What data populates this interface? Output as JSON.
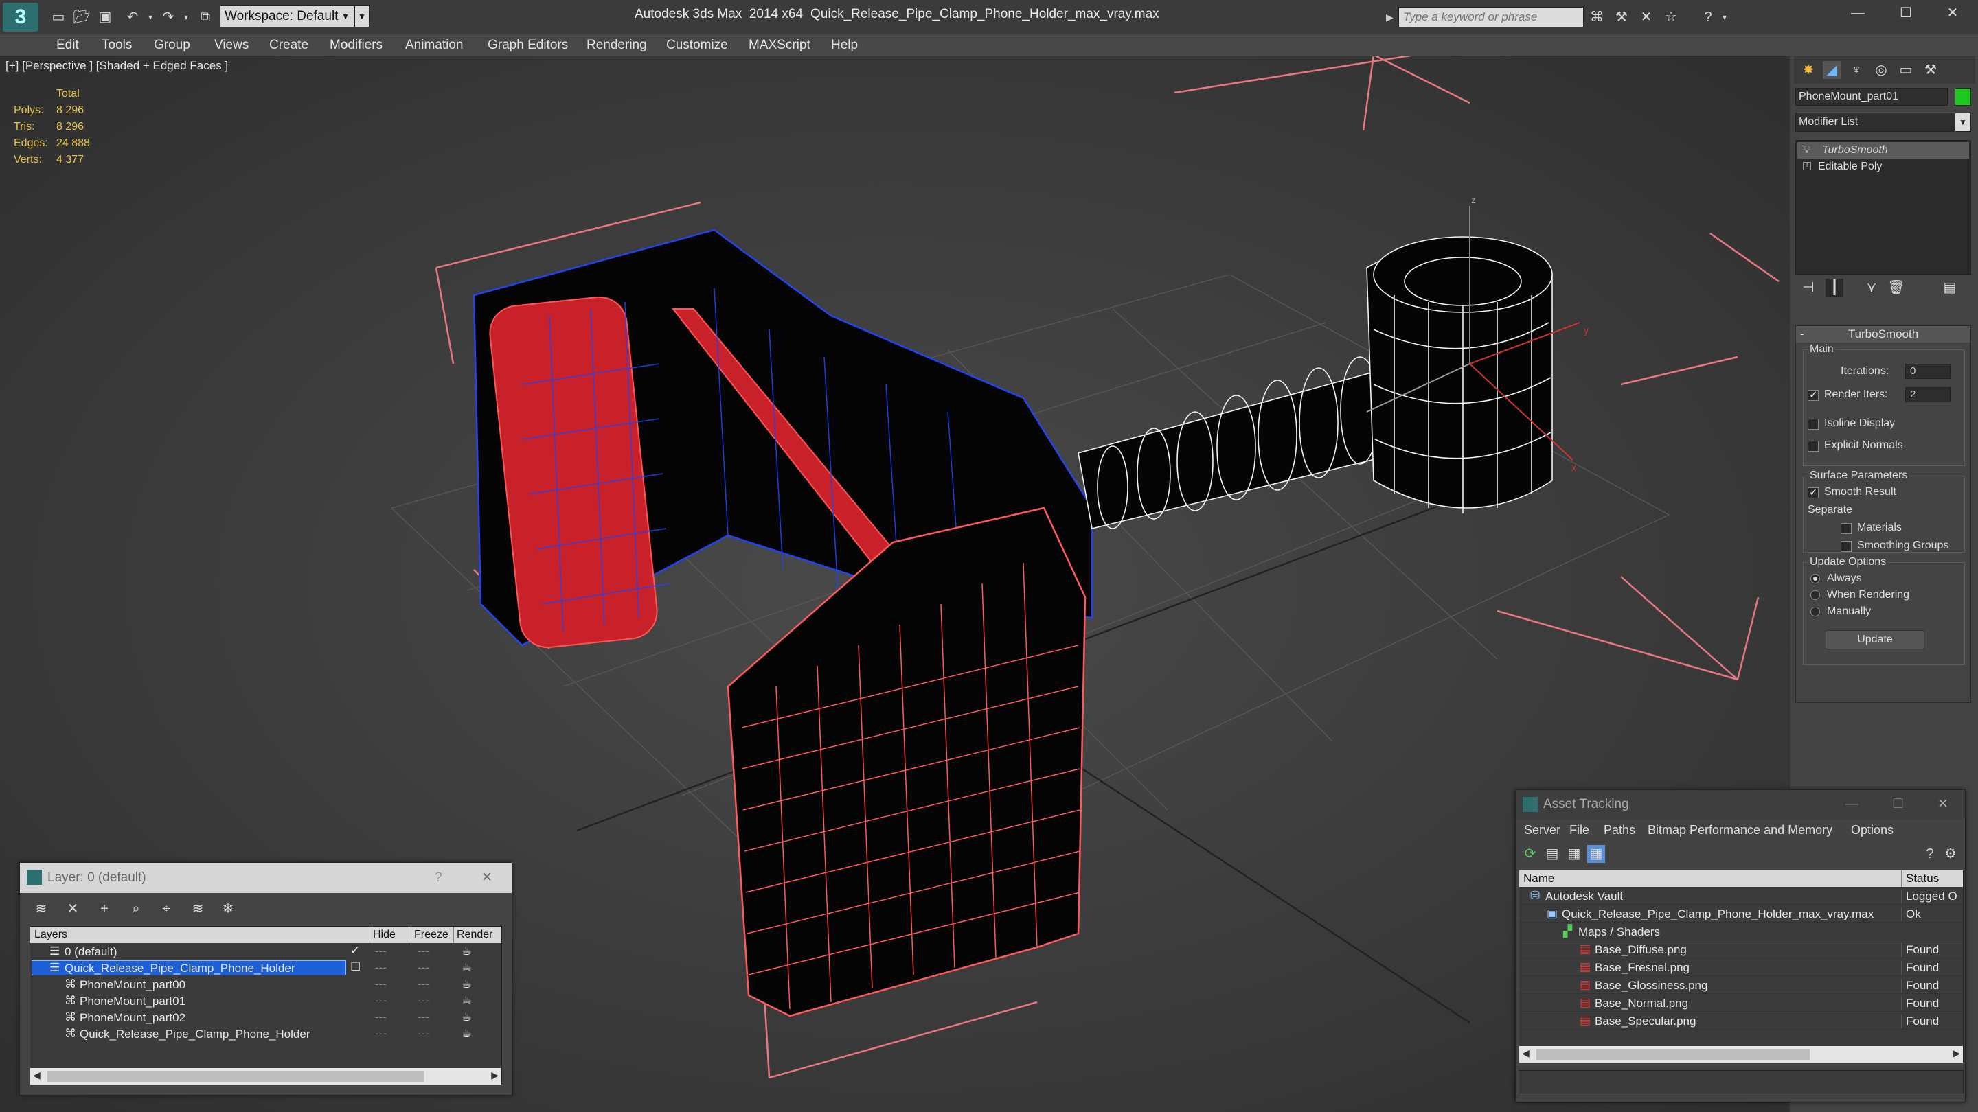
{
  "app": {
    "title": "Autodesk 3ds Max  2014 x64",
    "filename": "Quick_Release_Pipe_Clamp_Phone_Holder_max_vray.max",
    "workspace": "Workspace: Default",
    "search_placeholder": "Type a keyword or phrase"
  },
  "menu": [
    "Edit",
    "Tools",
    "Group",
    "Views",
    "Create",
    "Modifiers",
    "Animation",
    "Graph Editors",
    "Rendering",
    "Customize",
    "MAXScript",
    "Help"
  ],
  "viewport": {
    "label": "[+] [Perspective ] [Shaded + Edged Faces ]",
    "stats": {
      "header": "Total",
      "rows": [
        {
          "label": "Polys:",
          "value": "8 296"
        },
        {
          "label": "Tris:",
          "value": "8 296"
        },
        {
          "label": "Edges:",
          "value": "24 888"
        },
        {
          "label": "Verts:",
          "value": "4 377"
        }
      ]
    },
    "axis_labels": {
      "z": "z",
      "y": "y",
      "x": "x"
    }
  },
  "command_panel": {
    "object_name": "PhoneMount_part01",
    "object_color": "#1ec81e",
    "modifier_list": "Modifier List",
    "stack": [
      "TurboSmooth",
      "Editable Poly"
    ],
    "rollout_title": "TurboSmooth",
    "main_group": "Main",
    "iterations_label": "Iterations:",
    "iterations_value": "0",
    "render_iters_label": "Render Iters:",
    "render_iters_value": "2",
    "isoline_label": "Isoline Display",
    "explicit_normals_label": "Explicit Normals",
    "surface_params": "Surface Parameters",
    "smooth_result": "Smooth Result",
    "separate": "Separate",
    "materials": "Materials",
    "smoothing_groups": "Smoothing Groups",
    "update_options": "Update Options",
    "always": "Always",
    "when_rendering": "When Rendering",
    "manually": "Manually",
    "update_button": "Update"
  },
  "layer_window": {
    "title": "Layer: 0 (default)",
    "help": "?",
    "columns": [
      "Layers",
      "Hide",
      "Freeze",
      "Render"
    ],
    "rows": [
      {
        "name": "0 (default)",
        "checked": true
      },
      {
        "name": "Quick_Release_Pipe_Clamp_Phone_Holder",
        "selected": true
      },
      {
        "name": "PhoneMount_part00"
      },
      {
        "name": "PhoneMount_part01"
      },
      {
        "name": "PhoneMount_part02"
      },
      {
        "name": "Quick_Release_Pipe_Clamp_Phone_Holder"
      }
    ]
  },
  "asset_window": {
    "title": "Asset Tracking",
    "menu": [
      "Server",
      "File",
      "Paths",
      "Bitmap Performance and Memory",
      "Options"
    ],
    "columns": [
      "Name",
      "Status"
    ],
    "rows": [
      {
        "name": "Autodesk Vault",
        "status": "Logged O",
        "indent": 0
      },
      {
        "name": "Quick_Release_Pipe_Clamp_Phone_Holder_max_vray.max",
        "status": "Ok",
        "indent": 1
      },
      {
        "name": "Maps / Shaders",
        "status": "",
        "indent": 2
      },
      {
        "name": "Base_Diffuse.png",
        "status": "Found",
        "indent": 3
      },
      {
        "name": "Base_Fresnel.png",
        "status": "Found",
        "indent": 3
      },
      {
        "name": "Base_Glossiness.png",
        "status": "Found",
        "indent": 3
      },
      {
        "name": "Base_Normal.png",
        "status": "Found",
        "indent": 3
      },
      {
        "name": "Base_Specular.png",
        "status": "Found",
        "indent": 3
      }
    ]
  }
}
